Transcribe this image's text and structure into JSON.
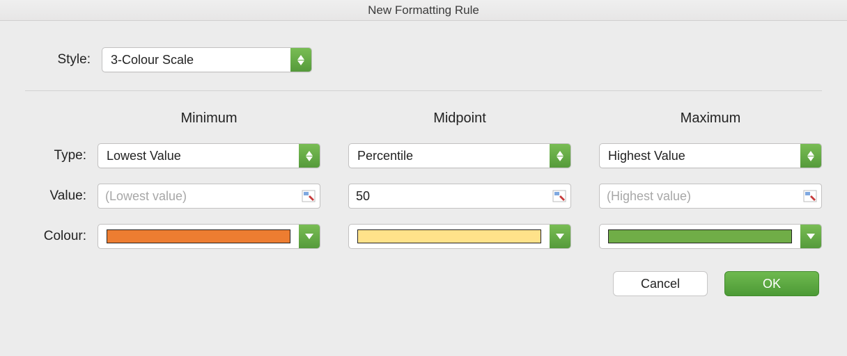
{
  "titlebar": {
    "title": "New Formatting Rule"
  },
  "labels": {
    "style": "Style:",
    "type": "Type:",
    "value": "Value:",
    "colour": "Colour:"
  },
  "style": {
    "selected": "3-Colour Scale"
  },
  "columns": {
    "minimum": {
      "header": "Minimum"
    },
    "midpoint": {
      "header": "Midpoint"
    },
    "maximum": {
      "header": "Maximum"
    }
  },
  "type": {
    "minimum": "Lowest Value",
    "midpoint": "Percentile",
    "maximum": "Highest Value"
  },
  "value": {
    "minimum_placeholder": "(Lowest value)",
    "midpoint": "50",
    "maximum_placeholder": "(Highest value)"
  },
  "colour": {
    "minimum": "#ed7d31",
    "midpoint": "#ffe28a",
    "maximum": "#70ad47"
  },
  "footer": {
    "cancel": "Cancel",
    "ok": "OK"
  }
}
